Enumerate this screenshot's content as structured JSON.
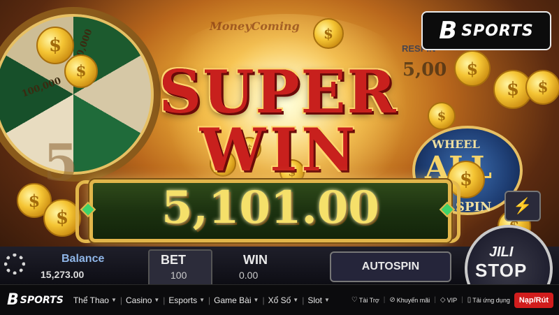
{
  "game": {
    "money_logo": "MoneyComing",
    "wheel_values": [
      "100,000",
      "20,000"
    ],
    "respin_label": "RESPIN",
    "respin_value": "5,00",
    "reel_digit": "5",
    "badge_top": "WHEEL",
    "badge_mid": "ALL",
    "badge_bottom": "SPIN",
    "super_text": "SUPER",
    "win_text": "WIN",
    "amount": "5,101.00",
    "balance_label": "Balance",
    "balance_value": "15,273.00",
    "bet_label": "BET",
    "bet_value": "100",
    "win_label": "WIN",
    "win_value": "0.00",
    "autospin_label": "AUTOSPIN",
    "stop_brand": "JILI",
    "stop_label": "STOP",
    "lightning_icon": "lightning-icon"
  },
  "brand": {
    "mark": "B",
    "text": "SPORTS"
  },
  "nav": {
    "logo_mark": "B",
    "logo_text": "SPORTS",
    "items": [
      {
        "label": "Thể Thao"
      },
      {
        "label": "Casino"
      },
      {
        "label": "Esports"
      },
      {
        "label": "Game Bài"
      },
      {
        "label": "Xổ Số"
      },
      {
        "label": "Slot"
      }
    ],
    "utility": [
      {
        "label": "Tài Trợ",
        "icon": "sponsor-icon"
      },
      {
        "label": "Khuyến mãi",
        "icon": "promo-icon"
      },
      {
        "label": "VIP",
        "icon": "diamond-icon"
      },
      {
        "label": "Tải ứng dụng",
        "icon": "phone-icon"
      }
    ],
    "cta_label": "Nạp/Rút"
  },
  "colors": {
    "cta_red": "#d11d1d",
    "gold": "#e2b64a",
    "title_red": "#c8201d"
  }
}
